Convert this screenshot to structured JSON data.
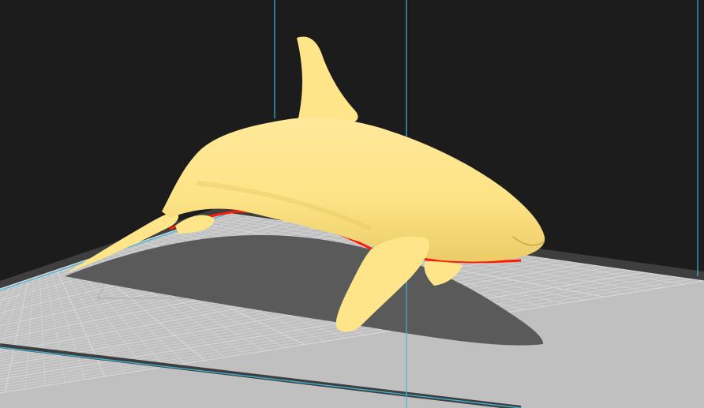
{
  "app": {
    "view": "3d-print-preview"
  },
  "scene": {
    "model": {
      "name": "orca-model",
      "color": "#ffe58a",
      "shade_color": "#e9c965",
      "overhang_color": "#ff1a00"
    },
    "build_plate": {
      "surface_color": "#c0c0c0",
      "grid_color": "#d8d8d8",
      "edge_color": "#3e3e3e"
    },
    "build_volume": {
      "line_color": "#3fb6dd"
    },
    "shadow_color": "#5a5a5a"
  }
}
